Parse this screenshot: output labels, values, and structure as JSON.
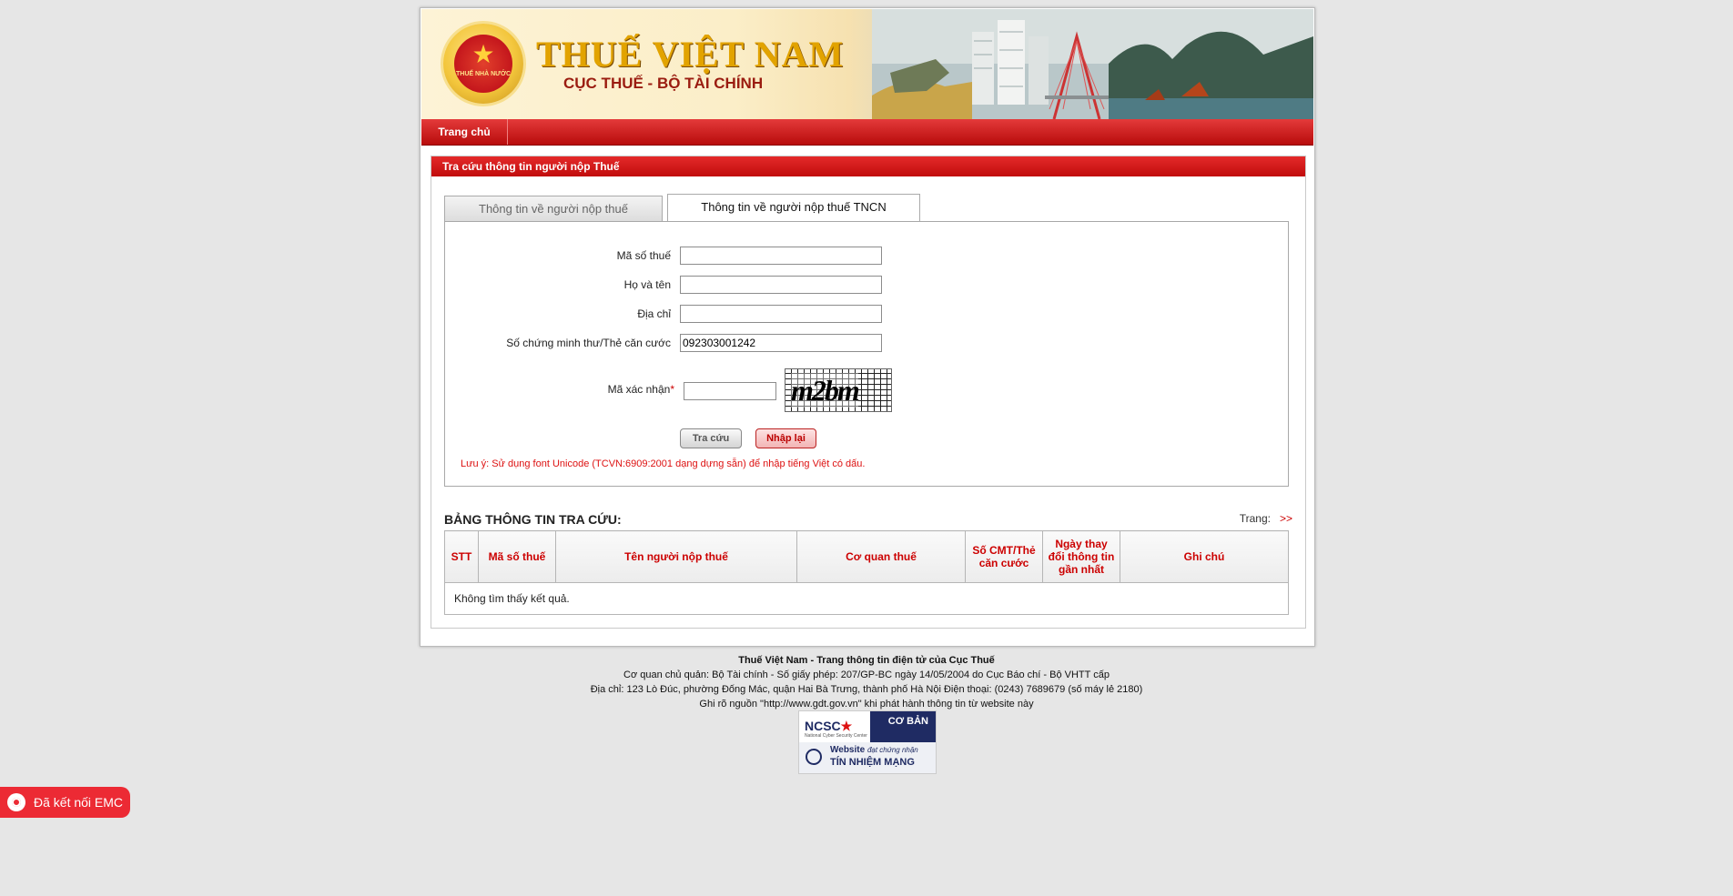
{
  "header": {
    "title": "THUẾ VIỆT NAM",
    "subtitle": "CỤC THUẾ - BỘ TÀI CHÍNH",
    "emblem_text": "THUẾ NHÀ NƯỚC"
  },
  "nav": {
    "home": "Trang chủ"
  },
  "panel": {
    "title": "Tra cứu thông tin người nộp Thuế"
  },
  "tabs": [
    {
      "label": "Thông tin về người nộp thuế",
      "active": false
    },
    {
      "label": "Thông tin về người nộp thuế TNCN",
      "active": true
    }
  ],
  "form": {
    "tax_code_label": "Mã số thuế",
    "tax_code_value": "",
    "name_label": "Họ và tên",
    "name_value": "",
    "address_label": "Địa chỉ",
    "address_value": "",
    "id_label": "Số chứng minh thư/Thẻ căn cước",
    "id_value": "092303001242",
    "captcha_label": "Mã xác nhận",
    "captcha_required": "*",
    "captcha_value": "",
    "captcha_image_text": "m2bm",
    "search_button": "Tra cứu",
    "reset_button": "Nhập lại",
    "note": "Lưu ý: Sử dụng font Unicode (TCVN:6909:2001 dạng dựng sẵn) để nhập tiếng Việt có dấu."
  },
  "results": {
    "title": "BẢNG THÔNG TIN TRA CỨU:",
    "page_label": "Trang:",
    "next": ">>",
    "columns": [
      "STT",
      "Mã số thuế",
      "Tên người nộp thuế",
      "Cơ quan thuế",
      "Số CMT/Thẻ căn cước",
      "Ngày thay đổi thông tin gần nhất",
      "Ghi chú"
    ],
    "empty_message": "Không tìm thấy kết quả."
  },
  "footer": {
    "line1": "Thuế Việt Nam - Trang thông tin điện tử của Cục Thuế",
    "line2": "Cơ quan chủ quản: Bộ Tài chính - Số giấy phép: 207/GP-BC ngày 14/05/2004 do Cục Báo chí - Bộ VHTT cấp",
    "line3": "Địa chỉ: 123 Lò Đúc, phường Đống Mác, quận Hai Bà Trưng, thành phố Hà Nội Điện thoại: (0243) 7689679 (số máy lẻ 2180)",
    "line4": "Ghi rõ nguồn \"http://www.gdt.gov.vn\" khi phát hành thông tin từ website này"
  },
  "ncsc_badge": {
    "logo": "NCSC",
    "small": "National Cyber Security Center",
    "level": "CƠ BẢN",
    "line1_a": "Website",
    "line1_b": "đạt chứng nhận",
    "line2": "TÍN NHIỆM MẠNG"
  },
  "emc": {
    "label": "Đã kết nối EMC"
  },
  "colors": {
    "accent_red": "#c10c0c",
    "gold": "#e2a300",
    "navy": "#1f2b63"
  }
}
